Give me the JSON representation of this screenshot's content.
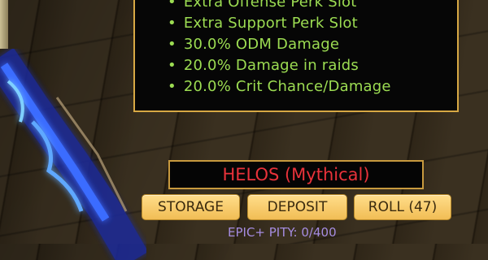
{
  "perk_panel": {
    "items": [
      {
        "bullet": "•",
        "label": "Extra Offense Perk Slot"
      },
      {
        "bullet": "•",
        "label": "Extra Support Perk Slot"
      },
      {
        "bullet": "•",
        "label": "30.0% ODM Damage"
      },
      {
        "bullet": "•",
        "label": "20.0% Damage in raids"
      },
      {
        "bullet": "•",
        "label": "20.0% Crit Chance/Damage"
      }
    ]
  },
  "item": {
    "name": "HELOS (Mythical)",
    "name_color": "#e8323a"
  },
  "buttons": {
    "storage": "STORAGE",
    "deposit": "DEPOSIT",
    "roll": "ROLL (47)"
  },
  "pity": {
    "text": "EPIC+ PITY: 0/400"
  },
  "colors": {
    "perk_text": "#9cdc52",
    "panel_border": "#d7a844",
    "button_bg": "#f4c65e",
    "pity_text": "#a58ce0"
  }
}
